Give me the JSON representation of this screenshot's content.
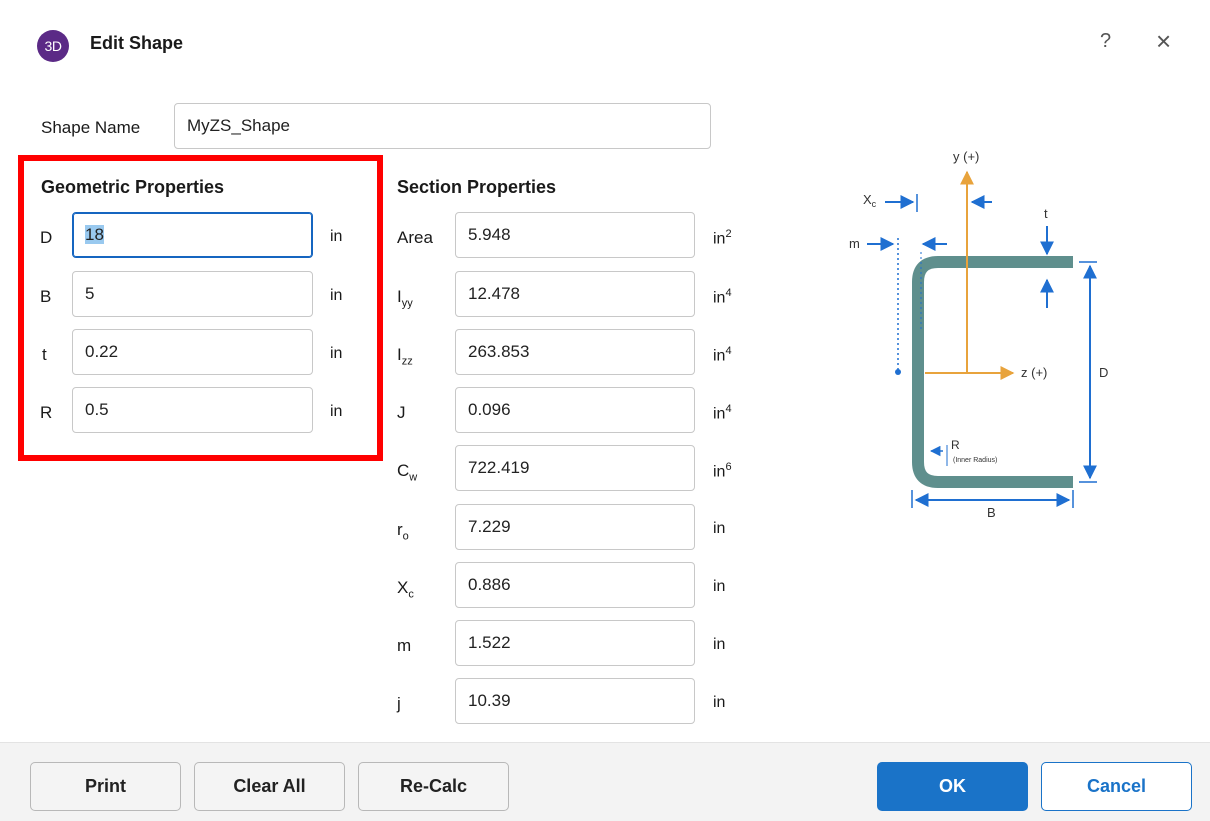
{
  "window": {
    "title": "Edit Shape",
    "app_icon_text": "3D",
    "help": "?",
    "close": "×"
  },
  "shape_name": {
    "label": "Shape Name",
    "value": "MyZS_Shape"
  },
  "geometric": {
    "title": "Geometric Properties",
    "rows": [
      {
        "label": "D",
        "value": "18",
        "unit": "in"
      },
      {
        "label": "B",
        "value": "5",
        "unit": "in"
      },
      {
        "label": "t",
        "value": "0.22",
        "unit": "in"
      },
      {
        "label": "R",
        "value": "0.5",
        "unit": "in"
      }
    ]
  },
  "section": {
    "title": "Section Properties",
    "rows": [
      {
        "label": "Area",
        "sub": "",
        "value": "5.948",
        "unit": "in",
        "exp": "2"
      },
      {
        "label": "I",
        "sub": "yy",
        "value": "12.478",
        "unit": "in",
        "exp": "4"
      },
      {
        "label": "I",
        "sub": "zz",
        "value": "263.853",
        "unit": "in",
        "exp": "4"
      },
      {
        "label": "J",
        "sub": "",
        "value": "0.096",
        "unit": "in",
        "exp": "4"
      },
      {
        "label": "C",
        "sub": "w",
        "value": "722.419",
        "unit": "in",
        "exp": "6"
      },
      {
        "label": "r",
        "sub": "o",
        "value": "7.229",
        "unit": "in",
        "exp": ""
      },
      {
        "label": "X",
        "sub": "c",
        "value": "0.886",
        "unit": "in",
        "exp": ""
      },
      {
        "label": "m",
        "sub": "",
        "value": "1.522",
        "unit": "in",
        "exp": ""
      },
      {
        "label": "j",
        "sub": "",
        "value": "10.39",
        "unit": "in",
        "exp": ""
      }
    ]
  },
  "diagram": {
    "y_axis": "y (+)",
    "z_axis": "z (+)",
    "xc": "X",
    "xc_sub": "c",
    "m": "m",
    "t": "t",
    "D": "D",
    "B": "B",
    "R": "R",
    "R_note": "(Inner Radius)",
    "colors": {
      "shape": "#5f8f8d",
      "dim": "#1f6fd1",
      "axis": "#e8a33c"
    }
  },
  "buttons": {
    "print": "Print",
    "clear_all": "Clear All",
    "recalc": "Re-Calc",
    "ok": "OK",
    "cancel": "Cancel"
  }
}
